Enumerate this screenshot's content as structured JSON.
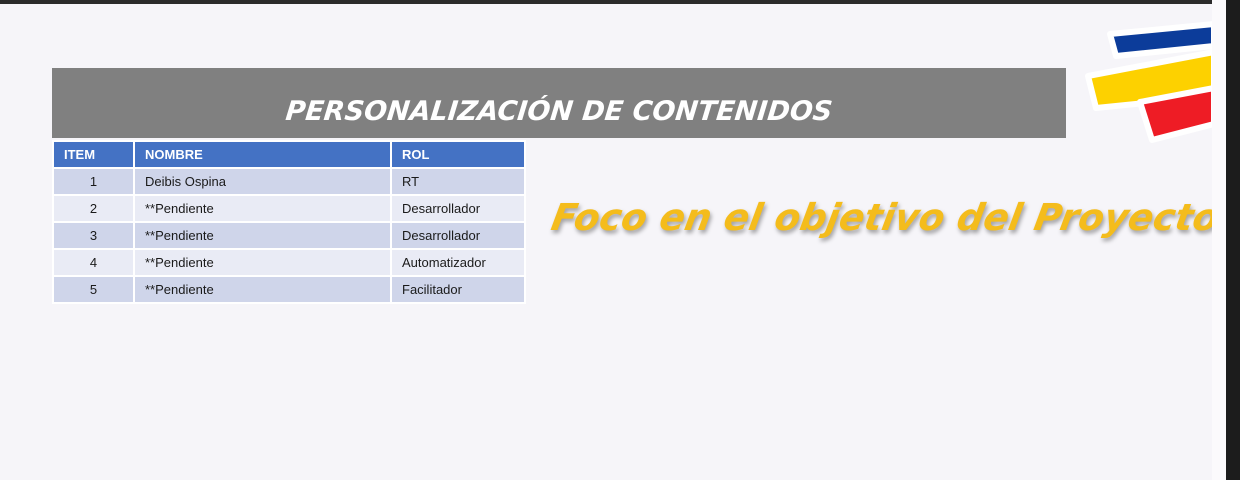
{
  "slide": {
    "title": "PERSONALIZACIÓN DE CONTENIDOS",
    "slogan": "Foco en el objetivo del Proyecto"
  },
  "table": {
    "headers": [
      "ITEM",
      "NOMBRE",
      "ROL"
    ],
    "rows": [
      {
        "item": "1",
        "nombre": "Deibis Ospina",
        "rol": "RT"
      },
      {
        "item": "2",
        "nombre": "**Pendiente",
        "rol": "Desarrollador"
      },
      {
        "item": "3",
        "nombre": "**Pendiente",
        "rol": "Desarrollador"
      },
      {
        "item": "4",
        "nombre": "**Pendiente",
        "rol": "Automatizador"
      },
      {
        "item": "5",
        "nombre": "**Pendiente",
        "rol": "Facilitador"
      }
    ]
  },
  "colors": {
    "banner": "#808080",
    "table_header": "#4472c4",
    "slogan": "#f4bc1c",
    "logo_blue": "#0c3c9a",
    "logo_yellow": "#fdd100",
    "logo_red": "#ee1c25"
  },
  "icons": {
    "logo": "tricolor-stripes-logo"
  }
}
